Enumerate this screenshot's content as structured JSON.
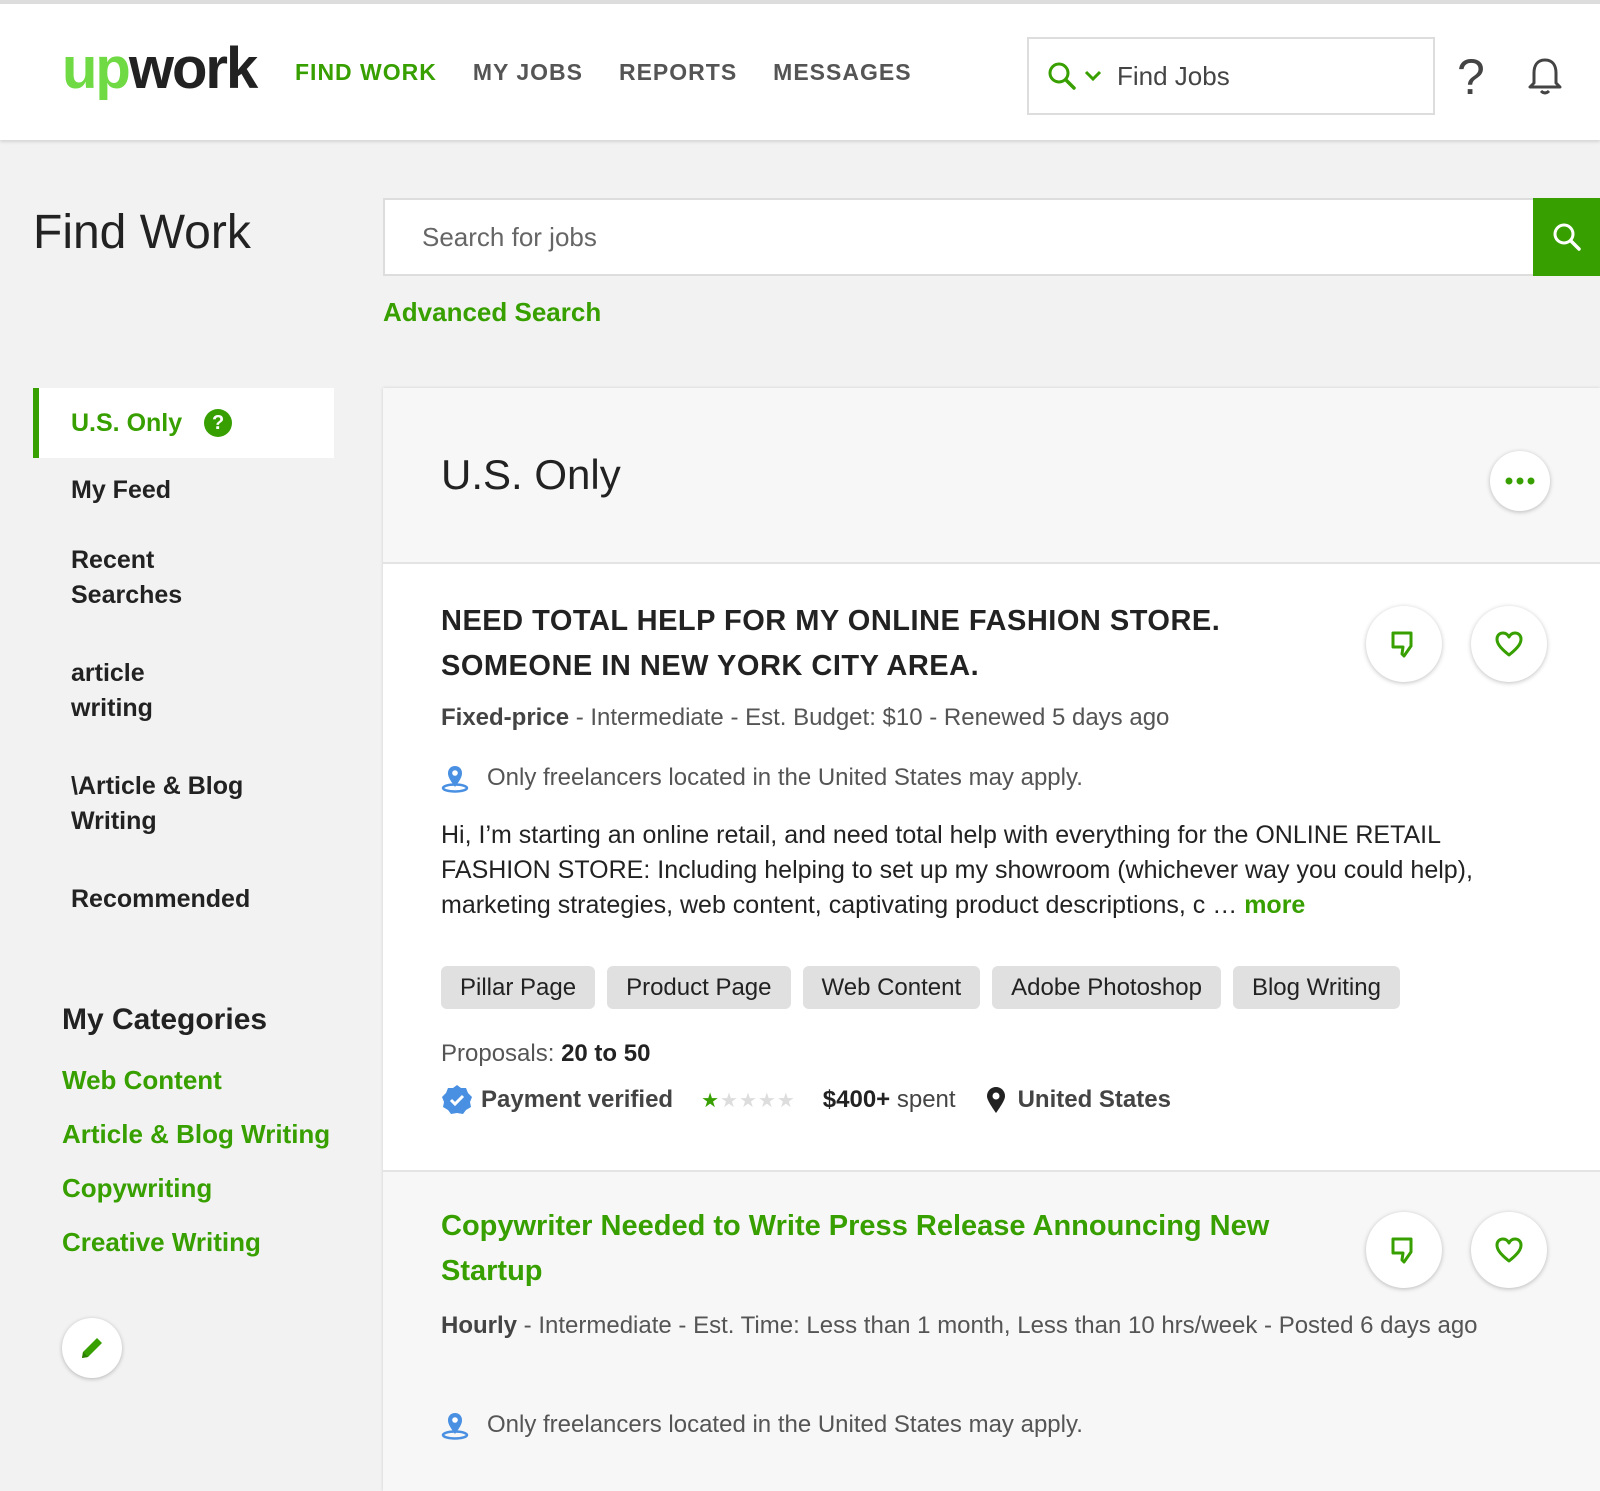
{
  "header": {
    "logo_up": "up",
    "logo_work": "work",
    "nav": [
      "FIND WORK",
      "MY JOBS",
      "REPORTS",
      "MESSAGES"
    ],
    "search_placeholder": "Find Jobs",
    "help": "?"
  },
  "page": {
    "title": "Find Work",
    "search_placeholder": "Search for jobs",
    "advanced_search": "Advanced Search"
  },
  "sidebar": {
    "items": [
      {
        "label": "U.S. Only",
        "active": true
      },
      {
        "label": "My Feed"
      },
      {
        "label": "Recent Searches"
      },
      {
        "label": "article writing"
      },
      {
        "label": "\\Article & Blog Writing"
      },
      {
        "label": "Recommended"
      }
    ],
    "help_icon": "?",
    "categories_title": "My Categories",
    "categories": [
      "Web Content",
      "Article & Blog Writing",
      "Copywriting",
      "Creative Writing"
    ]
  },
  "panel": {
    "title": "U.S. Only",
    "more_icon": "..."
  },
  "jobs": [
    {
      "title": "NEED TOTAL HELP FOR MY ONLINE FASHION STORE. SOMEONE IN NEW YORK CITY AREA.",
      "type": "Fixed-price",
      "meta_rest": " - Intermediate - Est. Budget: $10 - Renewed 5 days ago",
      "location_note": "Only freelancers located in the United States may apply.",
      "description": "Hi, I’m starting an online retail, and need total help with everything for the ONLINE RETAIL FASHION STORE: Including helping to set up my showroom (whichever way you could help), marketing strategies, web content, captivating product descriptions, c … ",
      "more": "more",
      "tags": [
        "Pillar Page",
        "Product Page",
        "Web Content",
        "Adobe Photoshop",
        "Blog Writing"
      ],
      "proposals_label": "Proposals: ",
      "proposals_value": "20 to 50",
      "payment": "Payment verified",
      "rating": 1,
      "spent_amount": "$400+",
      "spent_label": " spent",
      "country": "United States"
    },
    {
      "title": "Copywriter Needed to Write Press Release Announcing New Startup",
      "type": "Hourly",
      "meta_rest": " - Intermediate - Est. Time: Less than 1 month, Less than 10 hrs/week - Posted 6 days ago",
      "location_note": "Only freelancers located in the United States may apply."
    }
  ],
  "colors": {
    "brand_green": "#37a000",
    "logo_green": "#6fda44",
    "verified_blue": "#4a90e2"
  }
}
